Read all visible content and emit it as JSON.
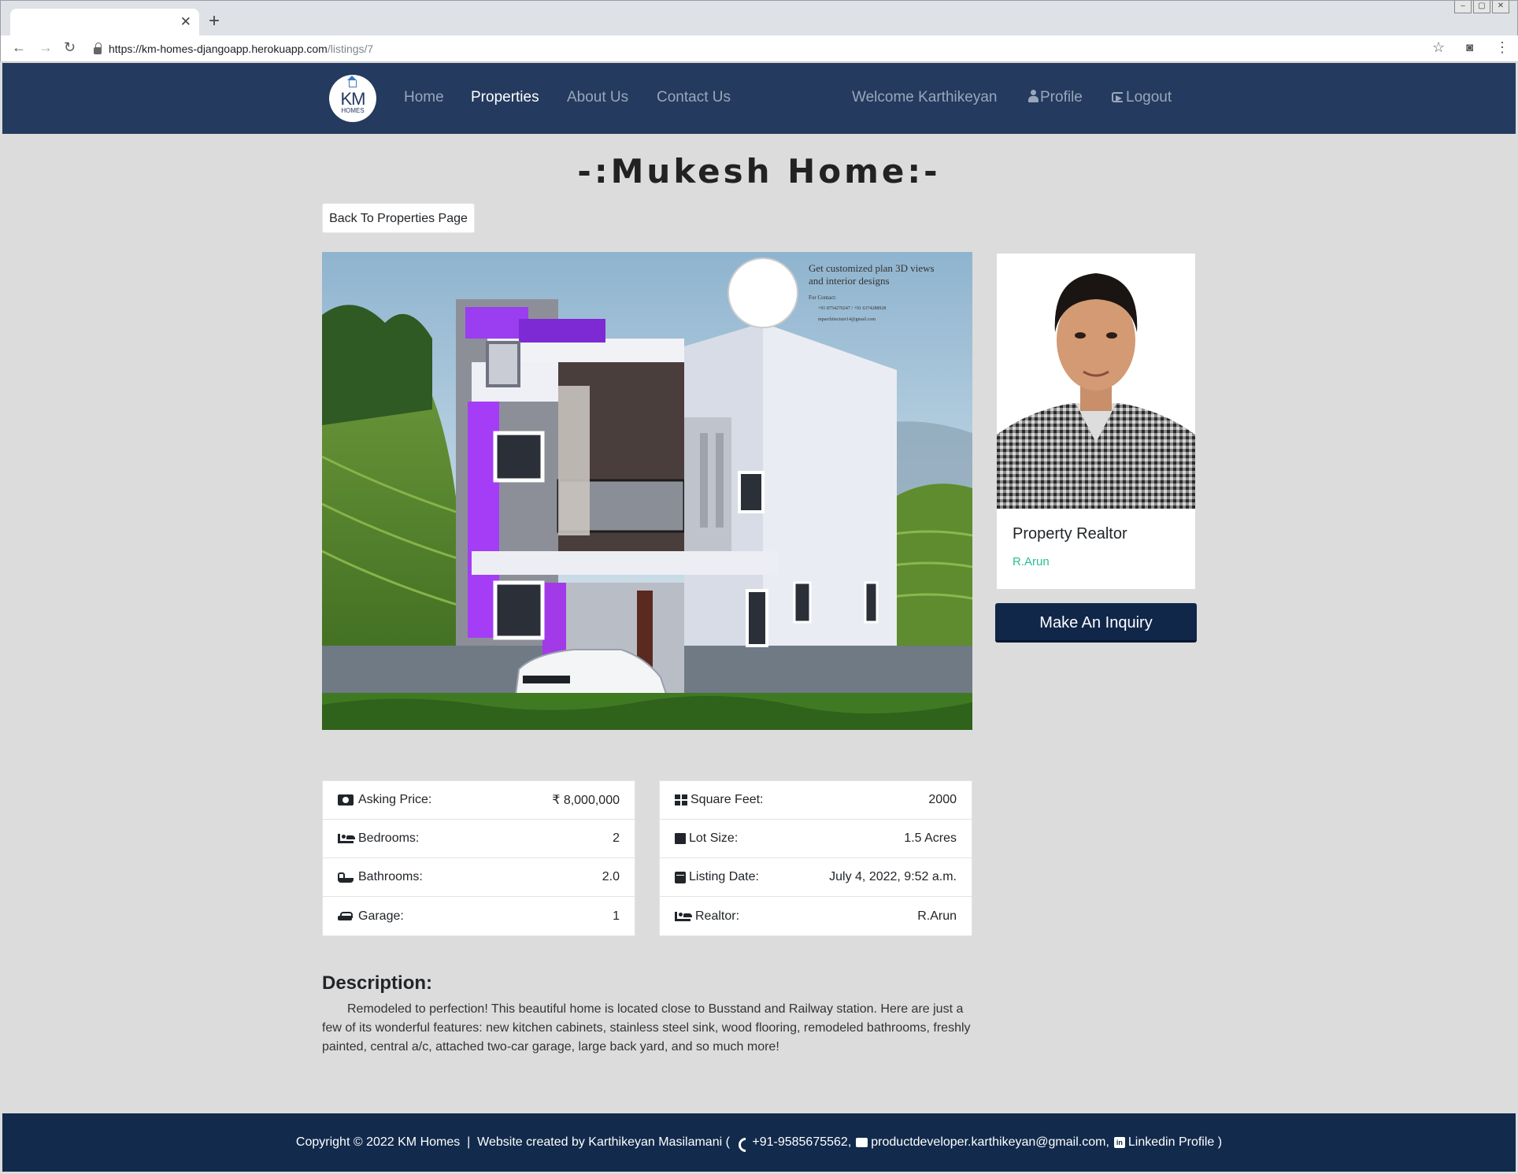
{
  "browser": {
    "url_host": "https://km-homes-djangoapp.herokuapp.com",
    "url_path": "/listings/7"
  },
  "nav": {
    "logo_text": "KM",
    "logo_sub": "HOMES",
    "links": [
      "Home",
      "Properties",
      "About Us",
      "Contact Us"
    ],
    "welcome": "Welcome Karthikeyan",
    "profile": "Profile",
    "logout": "Logout"
  },
  "listing": {
    "title": "-:Mukesh Home:-",
    "back_button": "Back To Properties Page",
    "image_text": {
      "line1": "Get customized  plan 3D views",
      "line2": "and interior designs",
      "contact_label": "For Contact:",
      "phone": "+91 8754270247 / +91 6374288928",
      "email": "mparchitecture14@gmail.com"
    },
    "details_left": [
      {
        "label": "Asking Price:",
        "value": "₹ 8,000,000",
        "icon": "money-icon"
      },
      {
        "label": "Bedrooms:",
        "value": "2",
        "icon": "bed-icon"
      },
      {
        "label": "Bathrooms:",
        "value": "2.0",
        "icon": "bath-icon"
      },
      {
        "label": "Garage:",
        "value": "1",
        "icon": "car-icon"
      }
    ],
    "details_right": [
      {
        "label": "Square Feet:",
        "value": "2000",
        "icon": "grid-icon"
      },
      {
        "label": "Lot Size:",
        "value": "1.5 Acres",
        "icon": "square-icon"
      },
      {
        "label": "Listing Date:",
        "value": "July 4, 2022, 9:52 a.m.",
        "icon": "calendar-icon"
      },
      {
        "label": "Realtor:",
        "value": "R.Arun",
        "icon": "bed-icon"
      }
    ],
    "description_title": "Description:",
    "description": "Remodeled to perfection! This beautiful home is located close to Busstand and Railway station. Here are just a few of its wonderful features: new kitchen cabinets, stainless steel sink, wood flooring, remodeled bathrooms, freshly painted, central a/c, attached two-car garage, large back yard, and so much more!"
  },
  "realtor": {
    "label": "Property Realtor",
    "name": "R.Arun",
    "inquiry_button": "Make An Inquiry"
  },
  "footer": {
    "copyright": "Copyright © 2022 KM Homes  |  Website created by Karthikeyan Masilamani ( ",
    "phone": "+91-9585675562,",
    "email": "productdeveloper.karthikeyan@gmail.com,",
    "linkedin": "Linkedin Profile )"
  },
  "colors": {
    "navbar": "#243a5e",
    "footer": "#122a4c",
    "accent_green": "#2bbd95",
    "button_dark": "#10274a",
    "page_bg": "#dcdcdc"
  }
}
